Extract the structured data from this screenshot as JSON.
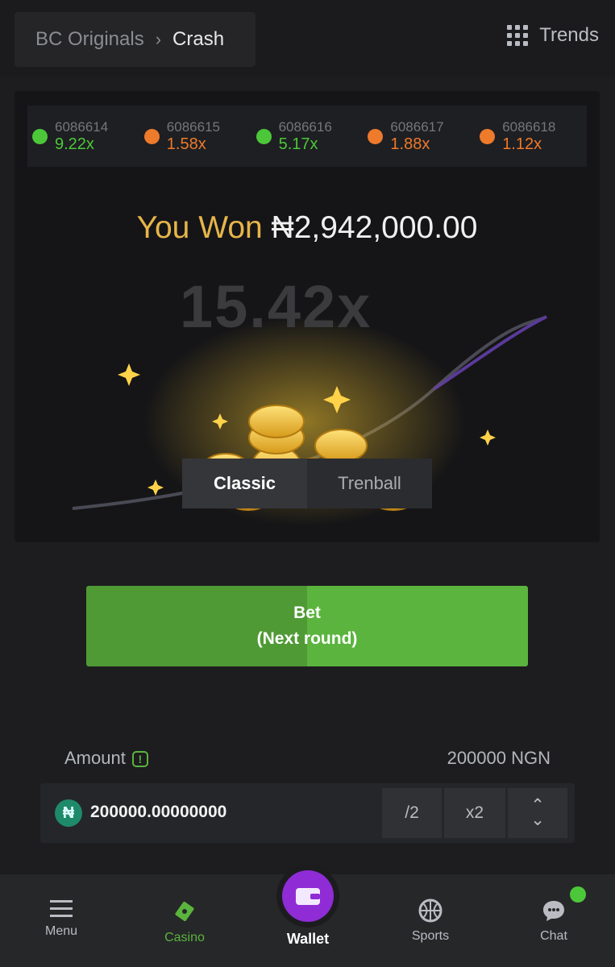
{
  "breadcrumb": {
    "parent": "BC Originals",
    "current": "Crash"
  },
  "trends_label": "Trends",
  "history": [
    {
      "id": "6086614",
      "multiplier": "9.22x",
      "color": "#4cc73a"
    },
    {
      "id": "6086615",
      "multiplier": "1.58x",
      "color": "#ee7a2b"
    },
    {
      "id": "6086616",
      "multiplier": "5.17x",
      "color": "#4cc73a"
    },
    {
      "id": "6086617",
      "multiplier": "1.88x",
      "color": "#ee7a2b"
    },
    {
      "id": "6086618",
      "multiplier": "1.12x",
      "color": "#ee7a2b"
    }
  ],
  "win": {
    "label": "You Won",
    "amount": "₦2,942,000.00"
  },
  "current_multiplier": "15.42x",
  "tabs": [
    {
      "label": "Classic",
      "active": true
    },
    {
      "label": "Trenball",
      "active": false
    }
  ],
  "bet_button": {
    "line1": "Bet",
    "line2": "(Next round)"
  },
  "amount": {
    "label": "Amount",
    "value_ngn": "200000 NGN",
    "input_value": "200000.00000000",
    "half": "/2",
    "double": "x2"
  },
  "nav": [
    {
      "label": "Menu",
      "icon": "menu-icon"
    },
    {
      "label": "Casino",
      "icon": "casino-icon"
    },
    {
      "label": "Wallet",
      "icon": "wallet-icon"
    },
    {
      "label": "Sports",
      "icon": "sports-icon"
    },
    {
      "label": "Chat",
      "icon": "chat-icon"
    }
  ],
  "colors": {
    "green": "#5ab43d",
    "orange": "#ee7a2b",
    "gold": "#e6b54a",
    "purple": "#8f2cd6"
  }
}
